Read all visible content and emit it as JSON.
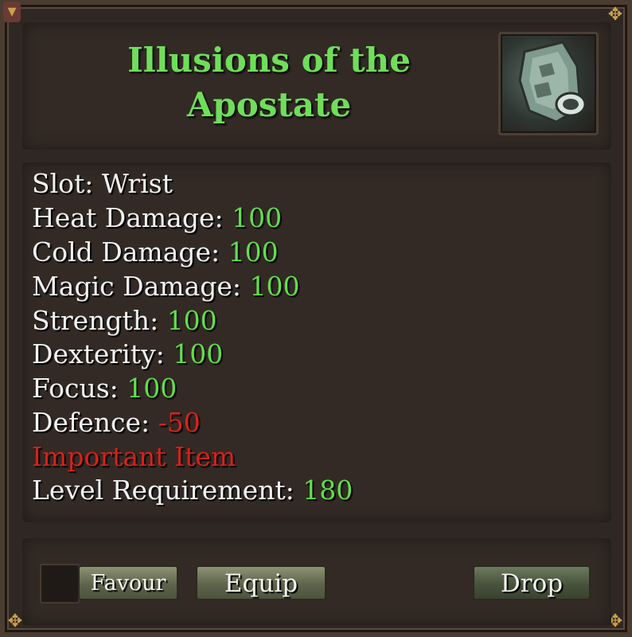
{
  "item": {
    "name_line1": "Illusions of the",
    "name_line2": "Apostate",
    "icon": "bracer-icon"
  },
  "stats": {
    "slot_label": "Slot:",
    "slot_value": "Wrist",
    "heat_label": "Heat Damage:",
    "heat_value": "100",
    "cold_label": "Cold Damage:",
    "cold_value": "100",
    "magic_label": "Magic Damage:",
    "magic_value": "100",
    "strength_label": "Strength:",
    "strength_value": "100",
    "dexterity_label": "Dexterity:",
    "dexterity_value": "100",
    "focus_label": "Focus:",
    "focus_value": "100",
    "defence_label": "Defence:",
    "defence_value": "-50",
    "important": "Important Item",
    "level_label": "Level Requirement:",
    "level_value": "180"
  },
  "buttons": {
    "favour": "Favour",
    "equip": "Equip",
    "drop": "Drop"
  },
  "colors": {
    "title": "#6fde5a",
    "positive": "#5fe04a",
    "negative": "#e0201b",
    "panel": "#332a25"
  }
}
